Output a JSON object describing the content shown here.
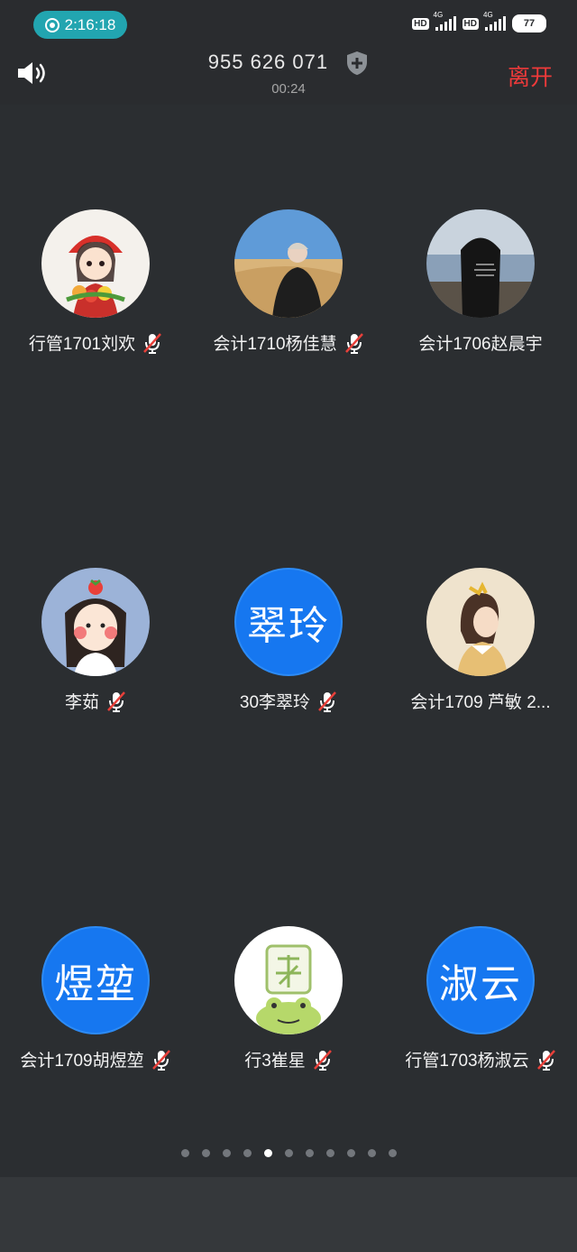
{
  "status_bar": {
    "recording_time": "2:16:18",
    "hd1": "HD",
    "hd2": "HD",
    "net1": "4G",
    "net2": "4G",
    "battery": "77"
  },
  "header": {
    "meeting_id": "955 626 071",
    "duration": "00:24",
    "leave_label": "离开"
  },
  "participants": [
    {
      "name": "行管1701刘欢",
      "muted": true,
      "avatar_type": "photo-girl-red-hat"
    },
    {
      "name": "会计1710杨佳慧",
      "muted": true,
      "avatar_type": "photo-desert"
    },
    {
      "name": "会计1706赵晨宇",
      "muted": false,
      "avatar_type": "photo-black-hoodie"
    },
    {
      "name": "李茹",
      "muted": true,
      "avatar_type": "cartoon-strawberry-girl"
    },
    {
      "name": "30李翠玲",
      "muted": true,
      "avatar_type": "text",
      "avatar_text": "翠玲"
    },
    {
      "name": "会计1709 芦敏 2...",
      "muted": false,
      "avatar_type": "illustration-girl"
    },
    {
      "name": "会计1709胡煜堃",
      "muted": true,
      "avatar_type": "text",
      "avatar_text": "煜堃"
    },
    {
      "name": "行3崔星",
      "muted": true,
      "avatar_type": "sticker-frog-mahjong"
    },
    {
      "name": "行管1703杨淑云",
      "muted": true,
      "avatar_type": "text",
      "avatar_text": "淑云"
    }
  ],
  "pagination": {
    "count": 11,
    "active_index": 4
  },
  "colors": {
    "accent": "#1677f0",
    "leave": "#ee3a3a",
    "muted_slash": "#e8403a",
    "background": "#2b2e31"
  }
}
